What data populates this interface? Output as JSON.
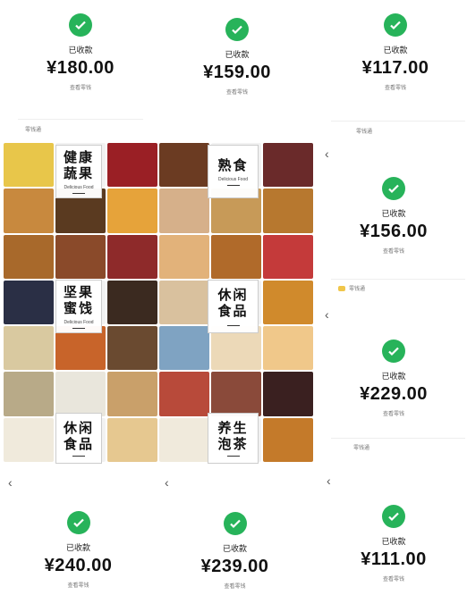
{
  "check_icon_color": "#27b35a",
  "receipts": [
    {
      "status": "已收款",
      "amount": "¥180.00",
      "sub": "查看零钱"
    },
    {
      "status": "已收款",
      "amount": "¥159.00",
      "sub": "查看零钱"
    },
    {
      "status": "已收款",
      "amount": "¥117.00",
      "sub": "查看零钱"
    },
    {
      "status": "已收款",
      "amount": "¥156.00",
      "sub": "查看零钱"
    },
    {
      "status": "已收款",
      "amount": "¥229.00",
      "sub": "查看零钱"
    },
    {
      "status": "已收款",
      "amount": "¥240.00",
      "sub": "查看零钱"
    },
    {
      "status": "已收款",
      "amount": "¥239.00",
      "sub": "查看零钱"
    },
    {
      "status": "已收款",
      "amount": "¥111.00",
      "sub": "查看零钱"
    }
  ],
  "strips": [
    "零钱通",
    "零钱通",
    "零钱通",
    "零钱通"
  ],
  "back_icon": "chevron-left-icon",
  "collage": {
    "labels": [
      {
        "title_line1": "健康",
        "title_line2": "蔬果",
        "caption": "Delicious Food"
      },
      {
        "title_line1": "熟食",
        "title_line2": "",
        "caption": "Delicious Food"
      },
      {
        "title_line1": "坚果",
        "title_line2": "蜜饯",
        "caption": "Delicious Food"
      },
      {
        "title_line1": "休闲",
        "title_line2": "食品",
        "caption": ""
      },
      {
        "title_line1": "休闲",
        "title_line2": "食品",
        "caption": ""
      },
      {
        "title_line1": "养生",
        "title_line2": "泡茶",
        "caption": ""
      }
    ],
    "tile_colors": [
      "#e8c64a",
      "#f2f2f2",
      "#9a1f25",
      "#6b3b22",
      "#f2f2f2",
      "#6a2a2a",
      "#c8893e",
      "#5a3a20",
      "#e6a33a",
      "#d6b08a",
      "#c79a58",
      "#b7782f",
      "#a8692b",
      "#8a4a2a",
      "#8e2a2a",
      "#e2b27a",
      "#b06a2a",
      "#c43a3a",
      "#2a2f45",
      "#f2f2f2",
      "#3b2a20",
      "#d9c19e",
      "#f2f2f2",
      "#d08a2c",
      "#d9c9a0",
      "#c8642a",
      "#6a4a30",
      "#7fa3c2",
      "#ecd9b8",
      "#f0c88a",
      "#b8aa88",
      "#e9e6dc",
      "#c9a06a",
      "#b84a3a",
      "#8a4a3a",
      "#3a2020",
      "#f0eadc",
      "#f2f2f2",
      "#e6c890",
      "#f0eadc",
      "#f2f2f2",
      "#c47a2a"
    ]
  }
}
